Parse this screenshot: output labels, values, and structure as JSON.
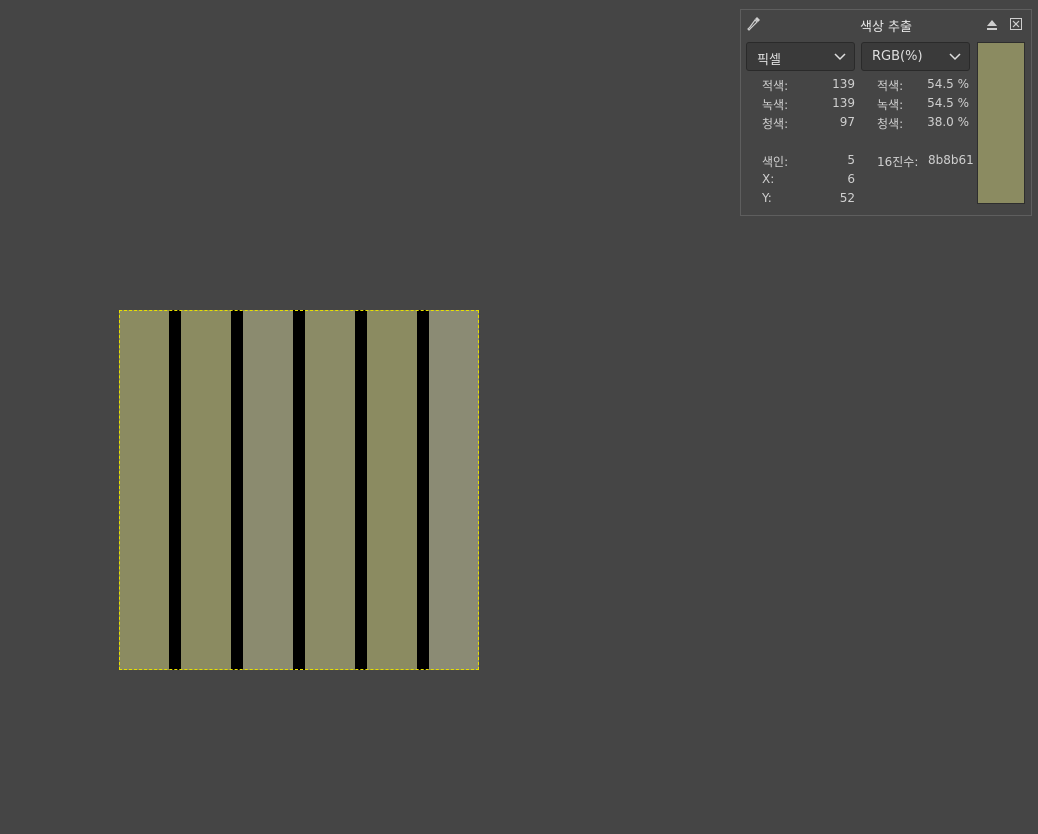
{
  "image": {
    "stripes": [
      {
        "color": "#8b8b61"
      },
      {
        "color": "#8b8b61"
      },
      {
        "color": "#8b8b6f"
      },
      {
        "color": "#8b8b66"
      },
      {
        "color": "#8b8b61"
      },
      {
        "color": "#8b8b74"
      }
    ],
    "divider_color": "#000000",
    "selection_border_color": "#e8e000"
  },
  "picker": {
    "title": "색상 추출",
    "icons": {
      "left": "eyedropper-icon",
      "up": "eject-icon",
      "close": "close-box-icon"
    },
    "mode_dropdown": "픽셀",
    "color_dropdown": "RGB(%)",
    "left_column": [
      {
        "label": "적색:",
        "value": "139"
      },
      {
        "label": "녹색:",
        "value": "139"
      },
      {
        "label": "청색:",
        "value": "97"
      }
    ],
    "right_column": [
      {
        "label": "적색:",
        "value": "54.5 %"
      },
      {
        "label": "녹색:",
        "value": "54.5 %"
      },
      {
        "label": "청색:",
        "value": "38.0 %"
      }
    ],
    "index_label": "색인:",
    "index_value": "5",
    "hex_label": "16진수:",
    "hex_value": "8b8b61",
    "x_label": "X:",
    "x_value": "6",
    "y_label": "Y:",
    "y_value": "52",
    "swatch_color": "#8b8b61"
  }
}
